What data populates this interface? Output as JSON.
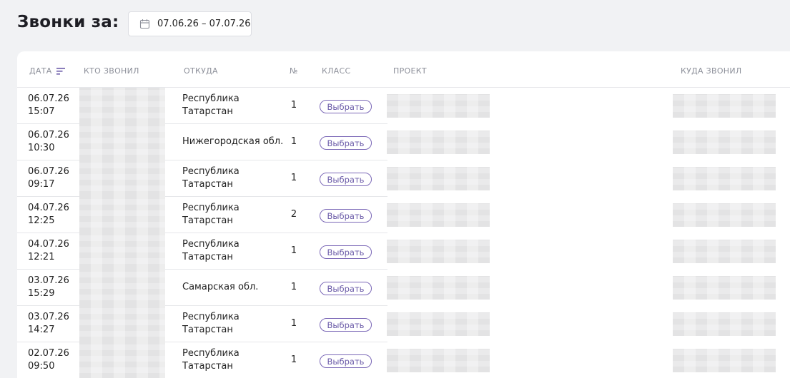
{
  "page": {
    "title": "Звонки за:"
  },
  "date_range": {
    "value": "07.06.26 – 07.07.26",
    "icon": "calendar-icon"
  },
  "table": {
    "headers": {
      "date": "ДАТА",
      "caller": "КТО ЗВОНИЛ",
      "region": "ОТКУДА",
      "num": "№",
      "class": "КЛАСС",
      "project": "ПРОЕКТ",
      "destination": "КУДА ЗВОНИЛ"
    },
    "sort_icon": "sort-icon",
    "accent_color": "#6a5aa8",
    "rows": [
      {
        "date": "06.07.26",
        "time": "15:07",
        "region": "Республика Татарстан",
        "num": "1",
        "class_label": "Выбрать"
      },
      {
        "date": "06.07.26",
        "time": "10:30",
        "region": "Нижегородская обл.",
        "num": "1",
        "class_label": "Выбрать"
      },
      {
        "date": "06.07.26",
        "time": "09:17",
        "region": "Республика Татарстан",
        "num": "1",
        "class_label": "Выбрать"
      },
      {
        "date": "04.07.26",
        "time": "12:25",
        "region": "Республика Татарстан",
        "num": "2",
        "class_label": "Выбрать"
      },
      {
        "date": "04.07.26",
        "time": "12:21",
        "region": "Республика Татарстан",
        "num": "1",
        "class_label": "Выбрать"
      },
      {
        "date": "03.07.26",
        "time": "15:29",
        "region": "Самарская обл.",
        "num": "1",
        "class_label": "Выбрать"
      },
      {
        "date": "03.07.26",
        "time": "14:27",
        "region": "Республика Татарстан",
        "num": "1",
        "class_label": "Выбрать"
      },
      {
        "date": "02.07.26",
        "time": "09:50",
        "region": "Республика Татарстан",
        "num": "1",
        "class_label": "Выбрать"
      }
    ]
  }
}
